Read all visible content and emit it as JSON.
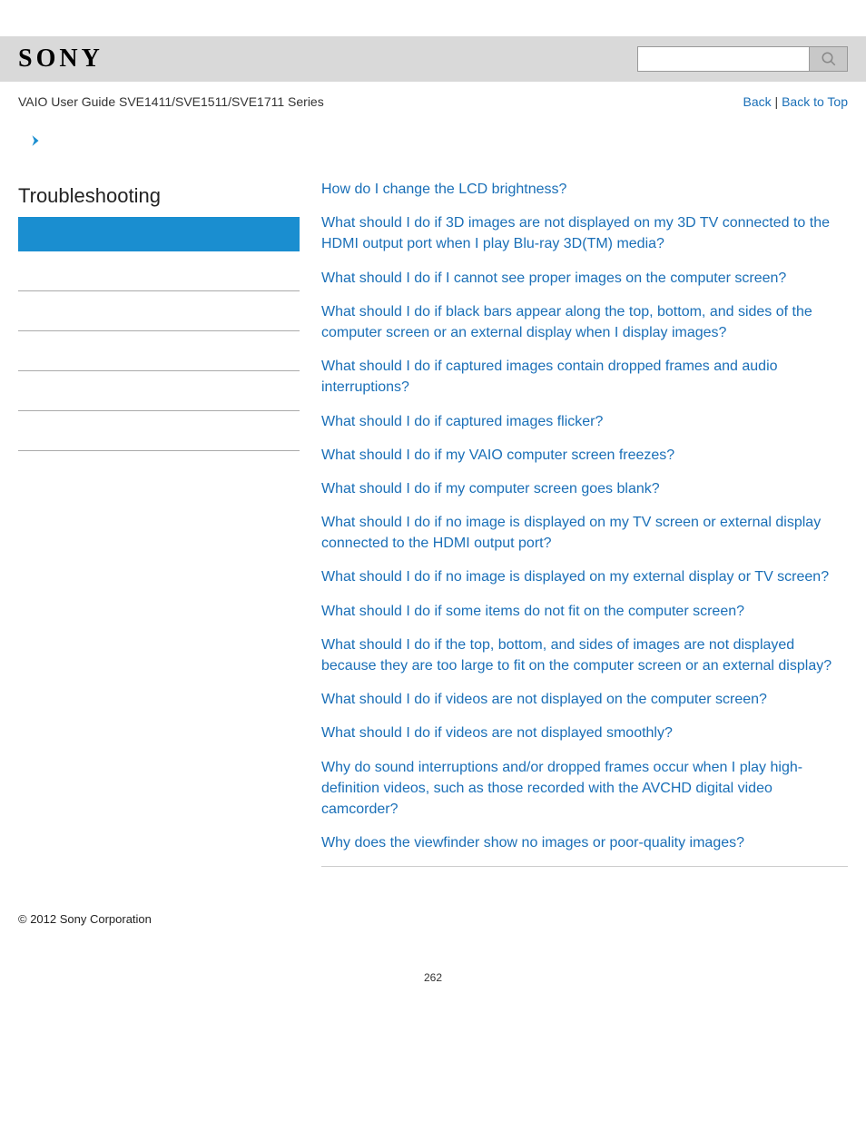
{
  "header": {
    "logo": "SONY",
    "doc_title": "VAIO User Guide SVE1411/SVE1511/SVE1711 Series",
    "back": "Back",
    "back_top": "Back to Top",
    "separator": " | "
  },
  "search": {
    "placeholder": ""
  },
  "sidebar": {
    "title": "Troubleshooting",
    "blank_rows": 5
  },
  "questions": [
    "How do I change the LCD brightness?",
    "What should I do if 3D images are not displayed on my 3D TV connected to the HDMI output port when I play Blu-ray 3D(TM) media?",
    "What should I do if I cannot see proper images on the computer screen?",
    "What should I do if black bars appear along the top, bottom, and sides of the computer screen or an external display when I display images?",
    "What should I do if captured images contain dropped frames and audio interruptions?",
    "What should I do if captured images flicker?",
    "What should I do if my VAIO computer screen freezes?",
    "What should I do if my computer screen goes blank?",
    "What should I do if no image is displayed on my TV screen or external display connected to the HDMI output port?",
    "What should I do if no image is displayed on my external display or TV screen?",
    "What should I do if some items do not fit on the computer screen?",
    "What should I do if the top, bottom, and sides of images are not displayed because they are too large to fit on the computer screen or an external display?",
    "What should I do if videos are not displayed on the computer screen?",
    "What should I do if videos are not displayed smoothly?",
    "Why do sound interruptions and/or dropped frames occur when I play high-definition videos, such as those recorded with the AVCHD digital video camcorder?",
    "Why does the viewfinder show no images or poor-quality images?"
  ],
  "footer": {
    "copyright": "© 2012 Sony Corporation"
  },
  "page_number": "262"
}
